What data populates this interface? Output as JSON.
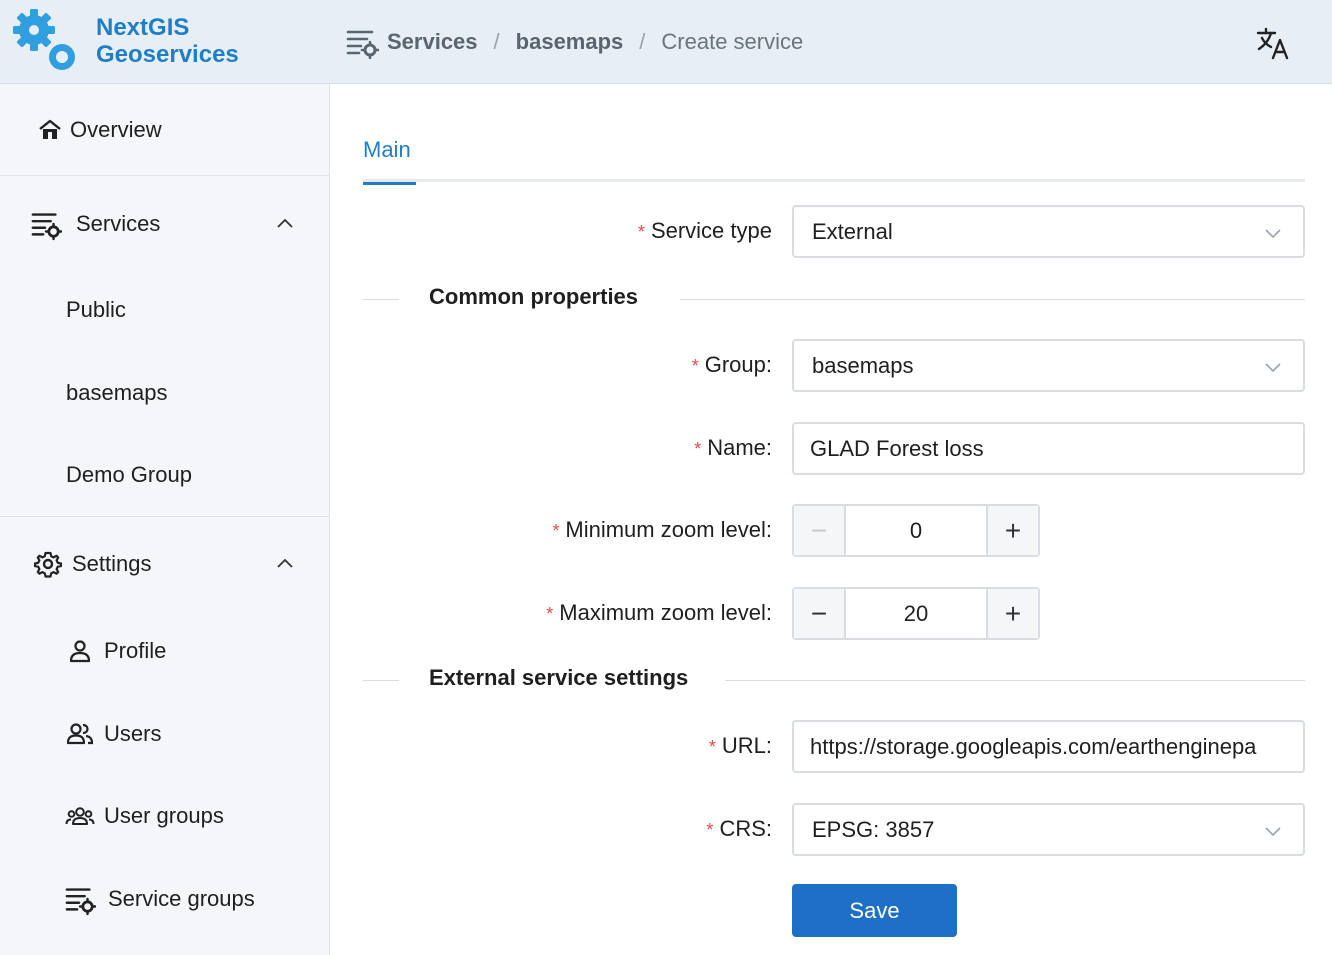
{
  "app": {
    "logo_line1": "NextGIS",
    "logo_line2": "Geoservices",
    "brand_color": "#1e7fc6"
  },
  "breadcrumb": {
    "items": [
      "Services",
      "basemaps",
      "Create service"
    ],
    "separator": "/"
  },
  "sidebar": {
    "overview": "Overview",
    "services": {
      "label": "Services",
      "expanded": true,
      "children": [
        "Public",
        "basemaps",
        "Demo Group"
      ]
    },
    "settings": {
      "label": "Settings",
      "expanded": true,
      "children": [
        "Profile",
        "Users",
        "User groups",
        "Service groups"
      ]
    }
  },
  "tabs": [
    "Main"
  ],
  "form": {
    "service_type": {
      "label": "Service type",
      "value": "External"
    },
    "common_section": "Common properties",
    "group": {
      "label": "Group:",
      "value": "basemaps"
    },
    "name": {
      "label": "Name:",
      "value": "GLAD Forest loss"
    },
    "min_zoom": {
      "label": "Minimum zoom level:",
      "value": "0"
    },
    "max_zoom": {
      "label": "Maximum zoom level:",
      "value": "20"
    },
    "external_section": "External service settings",
    "url": {
      "label": "URL:",
      "value": "https://storage.googleapis.com/earthenginepa"
    },
    "crs": {
      "label": "CRS:",
      "value": "EPSG: 3857"
    },
    "required_mark": "*",
    "stepper_minus": "−",
    "stepper_plus": "+",
    "save_label": "Save"
  },
  "colors": {
    "accent": "#1e7fc6",
    "button": "#1e6fc6",
    "required": "#e34b4b"
  }
}
